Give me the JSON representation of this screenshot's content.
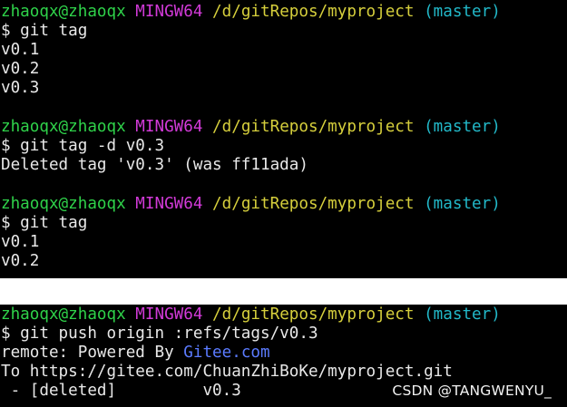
{
  "prompt": {
    "user_host": "zhaoqx@zhaoqx",
    "system": "MINGW64",
    "path": "/d/gitRepos/myproject",
    "branch": "(master)"
  },
  "colors": {
    "user_host": "#2fd24a",
    "system": "#d23ad8",
    "path": "#d6cf3c",
    "branch": "#22b8c8",
    "text": "#e8e8e8",
    "link": "#5b7bff",
    "background": "#000000"
  },
  "top_session": {
    "block1": {
      "command": "$ git tag",
      "output": [
        "v0.1",
        "v0.2",
        "v0.3"
      ]
    },
    "block2": {
      "command": "$ git tag -d v0.3",
      "output": [
        "Deleted tag 'v0.3' (was ff11ada)"
      ]
    },
    "block3": {
      "command": "$ git tag",
      "output": [
        "v0.1",
        "v0.2"
      ]
    }
  },
  "bottom_session": {
    "command": "$ git push origin :refs/tags/v0.3",
    "remote_prefix": "remote: Powered By ",
    "remote_link": "Gitee.com",
    "to_line": "To https://gitee.com/ChuanZhiBoKe/myproject.git",
    "deleted_line": " - [deleted]         v0.3"
  },
  "watermark": "CSDN @TANGWENYU_"
}
